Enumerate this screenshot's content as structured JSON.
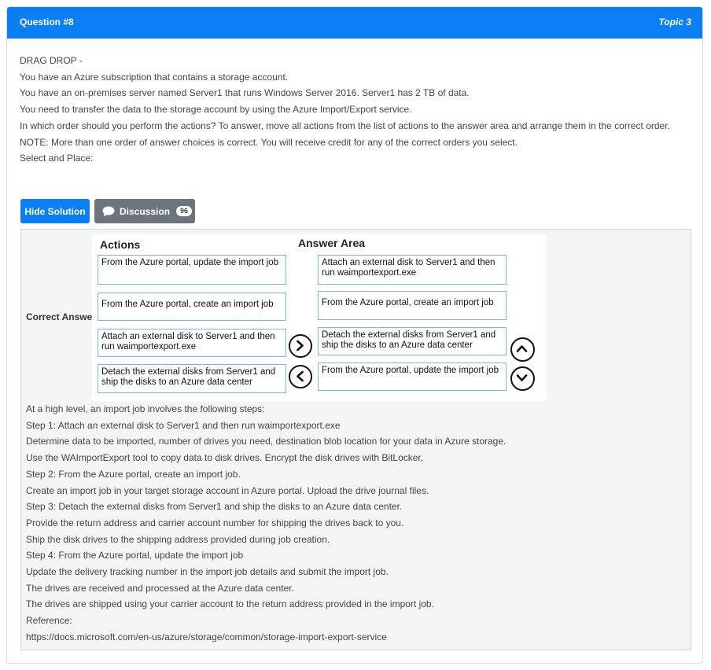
{
  "header": {
    "question_label": "Question #8",
    "topic_label": "Topic 3"
  },
  "question_lines": [
    "DRAG DROP -",
    "You have an Azure subscription that contains a storage account.",
    "You have an on-premises server named Server1 that runs Windows Server 2016. Server1 has 2 TB of data.",
    "You need to transfer the data to the storage account by using the Azure Import/Export service.",
    "In which order should you perform the actions? To answer, move all actions from the list of actions to the answer area and arrange them in the correct order.",
    "NOTE: More than one order of answer choices is correct. You will receive credit for any of the correct orders you select.",
    "Select and Place:"
  ],
  "buttons": {
    "hide_solution": "Hide Solution",
    "discussion": "Discussion",
    "discussion_count": "96"
  },
  "icons": {
    "discussion": "chat-bubble-icon",
    "move_right": "chevron-right-icon",
    "move_left": "chevron-left-icon",
    "move_up": "chevron-up-icon",
    "move_down": "chevron-down-icon"
  },
  "answer": {
    "label": "Correct Answer:",
    "actions_title": "Actions",
    "answer_area_title": "Answer Area",
    "actions": [
      "From the Azure portal, update the import job",
      "From the Azure portal, create an import job",
      "Attach an external disk to Server1 and then run waimportexport.exe",
      "Detach the external disks from Server1 and ship the disks to an Azure data center"
    ],
    "answer_area": [
      "Attach an external disk to Server1 and then run waimportexport.exe",
      "From the Azure portal, create an import job",
      "Detach the external disks from Server1 and ship the disks to an Azure data center",
      "From the Azure portal, update the import job"
    ]
  },
  "explanation_lines": [
    "At a high level, an import job involves the following steps:",
    "Step 1: Attach an external disk to Server1 and then run waimportexport.exe",
    "Determine data to be imported, number of drives you need, destination blob location for your data in Azure storage.",
    "Use the WAImportExport tool to copy data to disk drives. Encrypt the disk drives with BitLocker.",
    "Step 2: From the Azure portal, create an import job.",
    "Create an import job in your target storage account in Azure portal. Upload the drive journal files.",
    "Step 3: Detach the external disks from Server1 and ship the disks to an Azure data center.",
    "Provide the return address and carrier account number for shipping the drives back to you.",
    "Ship the disk drives to the shipping address provided during job creation.",
    "Step 4: From the Azure portal, update the import job",
    "Update the delivery tracking number in the import job details and submit the import job.",
    "The drives are received and processed at the Azure data center.",
    "The drives are shipped using your carrier account to the return address provided in the import job.",
    "Reference:",
    "https://docs.microsoft.com/en-us/azure/storage/common/storage-import-export-service"
  ],
  "colors": {
    "accent": "#0a7ff5",
    "secondary_button": "#6c757d",
    "box_border": "#7cb8d8"
  }
}
